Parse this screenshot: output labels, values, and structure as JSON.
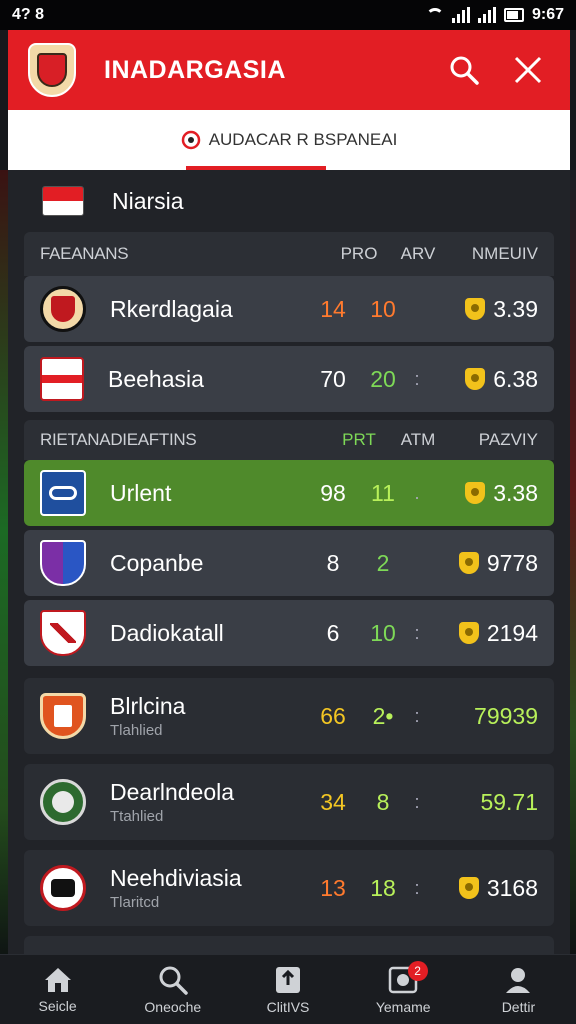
{
  "status_bar": {
    "left_text": "4? 8",
    "time": "9:67"
  },
  "header": {
    "title": "INADARGASIA"
  },
  "tab": {
    "label": "AUDACAR R BSPANEAI"
  },
  "league": {
    "name": "Niarsia"
  },
  "section1": {
    "title": "FAEANANS",
    "col1": "PRO",
    "col2": "ARV",
    "col3": "NMEUIV",
    "rows": [
      {
        "name": "Rkerdlagaia",
        "v1": "14",
        "v2": "10",
        "score": "3.39",
        "v1_color": "orange",
        "v2_color": "orange"
      },
      {
        "name": "Beehasia",
        "v1": "70",
        "v2": "20",
        "score": "6.38",
        "v1_color": "white",
        "v2_color": "green"
      }
    ]
  },
  "section2": {
    "title": "RIETANADIEAFTINS",
    "col1": "PRT",
    "col2": "ATM",
    "col3": "PAZVIY",
    "rows": [
      {
        "name": "Urlent",
        "v1": "98",
        "v2": "11",
        "score": "3.38",
        "v1_color": "white",
        "v2_color": "lime"
      },
      {
        "name": "Copanbe",
        "v1": "8",
        "v2": "2",
        "score": "9778",
        "v1_color": "white",
        "v2_color": "green"
      },
      {
        "name": "Dadiokatall",
        "v1": "6",
        "v2": "10",
        "score": "2194",
        "v1_color": "white",
        "v2_color": "green"
      }
    ]
  },
  "section3": {
    "rows": [
      {
        "name": "Blrlcina",
        "sub": "Tlahlied",
        "v1": "66",
        "v2": "2•",
        "score": "79939"
      },
      {
        "name": "Dearlndeola",
        "sub": "Ttahlied",
        "v1": "34",
        "v2": "8",
        "score": "59.71"
      },
      {
        "name": "Neehdiviasia",
        "sub": "Tlaritcd",
        "v1": "13",
        "v2": "18",
        "score": "3168"
      }
    ]
  },
  "nav": {
    "items": [
      {
        "label": "Seicle",
        "icon": "home-icon"
      },
      {
        "label": "Oneoche",
        "icon": "search-icon"
      },
      {
        "label": "ClitIVS",
        "icon": "clips-icon"
      },
      {
        "label": "Yemame",
        "icon": "ball-icon",
        "badge": "2"
      },
      {
        "label": "Dettir",
        "icon": "profile-icon"
      }
    ]
  },
  "colors": {
    "accent": "#e21e24",
    "active_row": "#4f8a2b",
    "gold": "#f2c21b"
  }
}
